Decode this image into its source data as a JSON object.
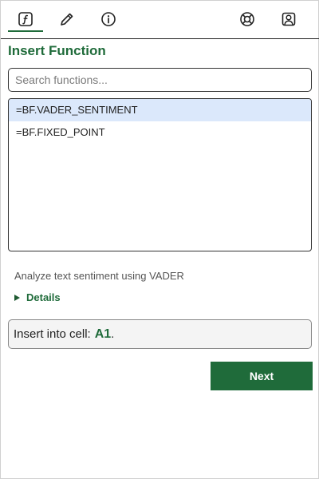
{
  "toolbar": {
    "buttons": [
      {
        "icon": "function-icon",
        "active": true
      },
      {
        "icon": "pencil-icon",
        "active": false
      },
      {
        "icon": "info-icon",
        "active": false
      },
      {
        "icon": "lifebuoy-icon",
        "active": false
      },
      {
        "icon": "user-portrait-icon",
        "active": false
      }
    ],
    "accent_color": "#1f6b3a"
  },
  "header": {
    "title": "Insert Function"
  },
  "search": {
    "value": "",
    "placeholder": "Search functions..."
  },
  "function_list": {
    "items": [
      {
        "label": "=BF.VADER_SENTIMENT",
        "selected": true
      },
      {
        "label": "=BF.FIXED_POINT",
        "selected": false
      }
    ],
    "selected_color": "#dbe8fb"
  },
  "description": "Analyze text sentiment using VADER",
  "details": {
    "label": "Details",
    "expanded": false
  },
  "insert_cell": {
    "prefix": "Insert into cell:",
    "cell": "A1",
    "suffix": "."
  },
  "actions": {
    "next_label": "Next"
  }
}
